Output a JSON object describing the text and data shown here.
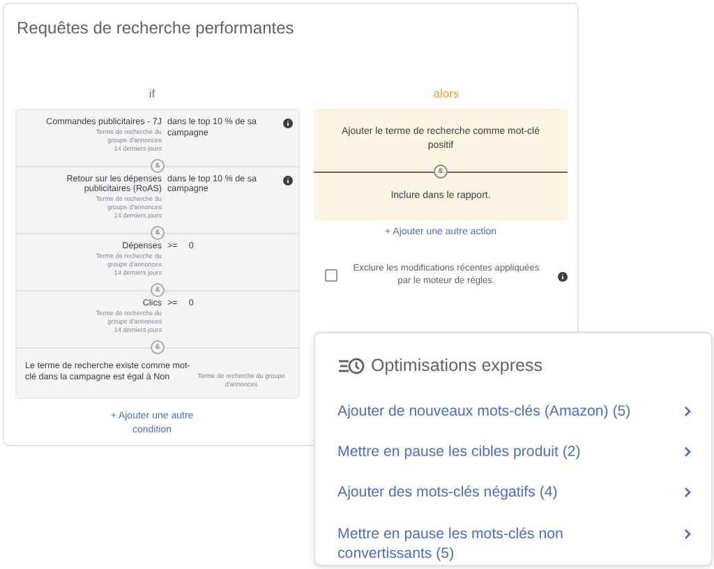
{
  "title": "Requêtes de recherche performantes",
  "if_label": "if",
  "conditions": [
    {
      "metric": "Commandes publicitaires - 7J",
      "value": "dans le top 10 % de sa campagne",
      "scope": "Terme de recherche du groupe d'annonces",
      "period": "14 derniers jours",
      "info": true,
      "connector": "&"
    },
    {
      "metric": "Retour sur les dépenses publicitaires (RoAS)",
      "value": "dans le top 10 % de sa campagne",
      "scope": "Terme de recherche du groupe d'annonces",
      "period": "14 derniers jours",
      "info": true,
      "connector": "&"
    },
    {
      "metric": "Dépenses",
      "operator": ">=",
      "value": "0",
      "scope": "Terme de recherche du groupe d'annonces",
      "period": "14 derniers jours",
      "connector": "&"
    },
    {
      "metric": "Clics",
      "operator": ">=",
      "value": "0",
      "scope": "Terme de recherche du groupe d'annonces",
      "period": "14 derniers jours",
      "connector": "&"
    }
  ],
  "final_condition": {
    "text": "Le terme de recherche existe comme mot-clé dans la campagne est égal à Non",
    "scope": "Terme de recherche du groupe d'annonces"
  },
  "add_condition": "+ Ajouter une autre condition",
  "then_label": "alors",
  "actions": [
    {
      "text": "Ajouter le terme de recherche comme mot-clé positif",
      "connector": "&"
    },
    {
      "text": "Inclure dans le rapport."
    }
  ],
  "add_action": "+ Ajouter une autre action",
  "exclude": {
    "label": "Exclure les modifications récentes appliquées par le moteur de règles.",
    "checked": false,
    "info": true
  },
  "quick_panel": {
    "title": "Optimisations express",
    "items": [
      {
        "label": "Ajouter de nouveaux mots-clés (Amazon) (5)"
      },
      {
        "label": "Mettre en pause les cibles produit (2)"
      },
      {
        "label": "Ajouter des mots-clés négatifs (4)"
      },
      {
        "label": "Mettre en pause les mots-clés non convertissants (5)"
      }
    ]
  }
}
